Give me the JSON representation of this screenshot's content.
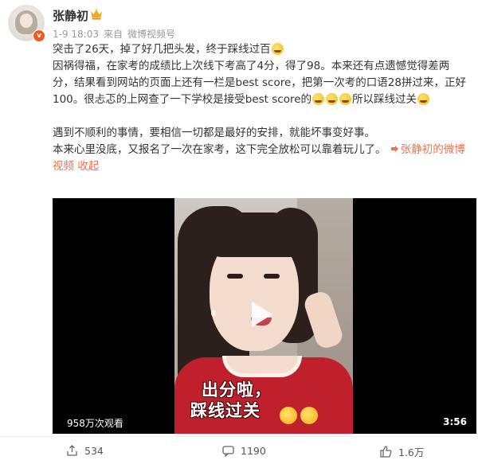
{
  "user": {
    "name": "张静初",
    "time": "1-9 18:03",
    "source_prefix": "来自",
    "source": "微博视频号",
    "verified_mark": "v"
  },
  "post": {
    "lines": [
      "突击了26天，掉了好几把头发，终于踩线过百",
      "因祸得福，在家考的成绩比上次线下考高了4分，得了98。本来还有点遗憾觉得差两",
      "分，结果看到网站的页面上还有一栏是best score，把第一次考的口语28拼过来，正好",
      "100。很忐忑的上网查了一下学校是接受best score的",
      "所以踩线过关",
      "遇到不顺利的事情，要相信一切都是最好的安排，就能坏事变好事。",
      "本来心里没底，又报名了一次在家考，这下完全放松可以靠着玩儿了。"
    ],
    "link_text": "张静初的微博",
    "tail_links": [
      "视频",
      "收起"
    ]
  },
  "video": {
    "caption_line1": "出分啦，",
    "caption_line2": "踩线过关",
    "views": "958万次观看",
    "duration": "3:56"
  },
  "actions": {
    "share_count": "534",
    "comment_count": "1190",
    "like_count": "1.6万"
  },
  "colors": {
    "link": "#eb7350",
    "accent": "#f05a1c"
  }
}
